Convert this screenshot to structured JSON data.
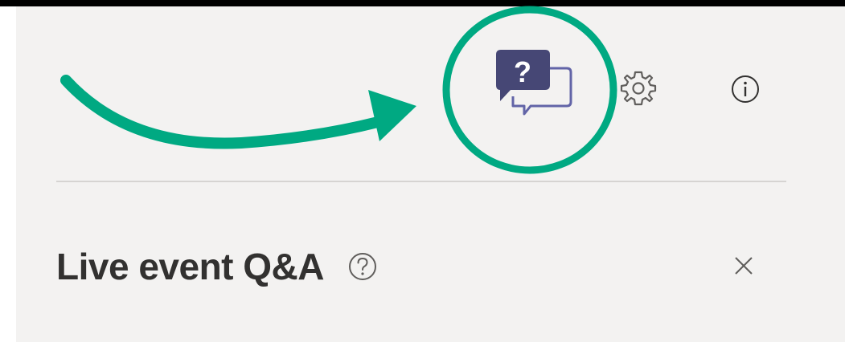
{
  "header": {
    "title": "Live event Q&A"
  },
  "toolbar": {
    "qa_icon": "qa-chat-icon",
    "settings_icon": "gear-icon",
    "info_icon": "info-icon"
  },
  "icons": {
    "help": "question-circle-icon",
    "close": "close-icon"
  },
  "colors": {
    "panel_background": "#f3f2f1",
    "top_bar": "#000000",
    "qa_icon_primary": "#464775",
    "qa_icon_secondary": "#6264a7",
    "annotation": "#00a982",
    "text": "#323130",
    "icon_gray": "#605e5c"
  }
}
